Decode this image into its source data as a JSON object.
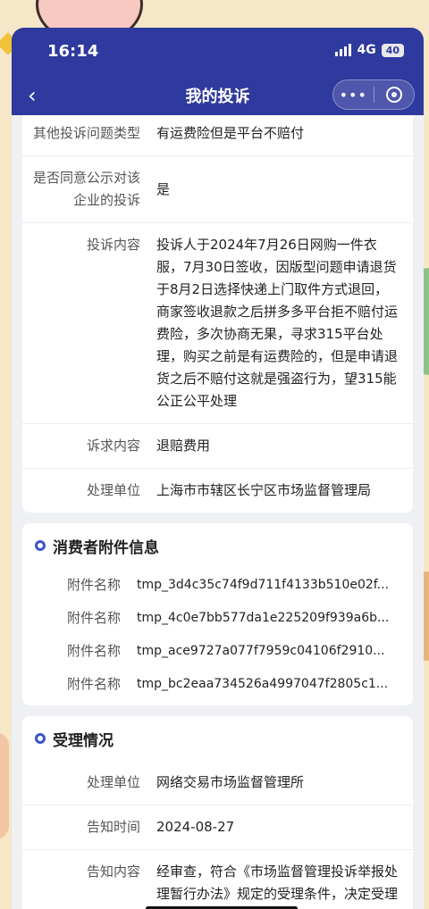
{
  "status_bar": {
    "time": "16:14",
    "network": "4G",
    "battery": "40"
  },
  "nav": {
    "back_icon": "chevron-left-icon",
    "title": "我的投诉",
    "more_icon": "more-dots-icon",
    "close_icon": "target-icon"
  },
  "complaint": {
    "rows": [
      {
        "label": "其他投诉问题类型",
        "value": "有运费险但是平台不赔付"
      },
      {
        "label": "是否同意公示对该企业的投诉",
        "value": "是"
      },
      {
        "label": "投诉内容",
        "value": "投诉人于2024年7月26日网购一件衣服，7月30日签收，因版型问题申请退货于8月2日选择快递上门取件方式退回，商家签收退款之后拼多多平台拒不赔付运费险，多次协商无果，寻求315平台处理，购买之前是有运费险的，但是申请退货之后不赔付这就是强盗行为，望315能公正公平处理"
      },
      {
        "label": "诉求内容",
        "value": "退赔费用"
      },
      {
        "label": "处理单位",
        "value": "上海市市辖区长宁区市场监督管理局"
      }
    ]
  },
  "attachments": {
    "title": "消费者附件信息",
    "items": [
      {
        "label": "附件名称",
        "value": "tmp_3d4c35c74f9d711f4133b510e02f..."
      },
      {
        "label": "附件名称",
        "value": "tmp_4c0e7bb577da1e225209f939a6b..."
      },
      {
        "label": "附件名称",
        "value": "tmp_ace9727a077f7959c04106f2910..."
      },
      {
        "label": "附件名称",
        "value": "tmp_bc2eaa734526a4997047f2805c1..."
      }
    ]
  },
  "acceptance": {
    "title": "受理情况",
    "rows": [
      {
        "label": "处理单位",
        "value": "网络交易市场监督管理所"
      },
      {
        "label": "告知时间",
        "value": "2024-08-27"
      },
      {
        "label": "告知内容",
        "value": "经审查，符合《市场监督管理投诉举报处理暂行办法》规定的受理条件，决定受理"
      }
    ]
  },
  "colors": {
    "nav_bg": "#2f3a9e",
    "accent": "#3b55c9",
    "page_bg": "#eef0f4"
  }
}
